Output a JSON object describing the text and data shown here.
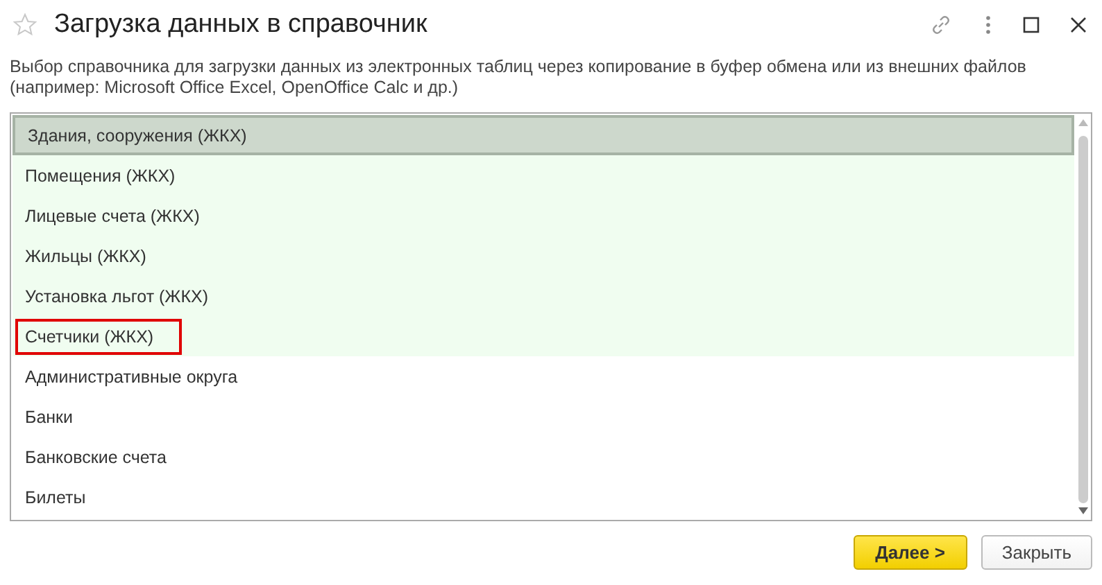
{
  "window": {
    "title": "Загрузка данных в справочник",
    "favorite": false
  },
  "description": "Выбор справочника для загрузки данных из электронных таблиц через копирование в буфер обмена или из внешних файлов (например: Microsoft Office Excel, OpenOffice Calc и др.)",
  "list": [
    {
      "label": "Здания, сооружения (ЖКХ)",
      "selected": true,
      "tinted": true,
      "outlined": false
    },
    {
      "label": "Помещения (ЖКХ)",
      "selected": false,
      "tinted": true,
      "outlined": false
    },
    {
      "label": "Лицевые счета (ЖКХ)",
      "selected": false,
      "tinted": true,
      "outlined": false
    },
    {
      "label": "Жильцы (ЖКХ)",
      "selected": false,
      "tinted": true,
      "outlined": false
    },
    {
      "label": "Установка льгот (ЖКХ)",
      "selected": false,
      "tinted": true,
      "outlined": false
    },
    {
      "label": "Счетчики (ЖКХ)",
      "selected": false,
      "tinted": true,
      "outlined": true
    },
    {
      "label": "Административные округа",
      "selected": false,
      "tinted": false,
      "outlined": false
    },
    {
      "label": "Банки",
      "selected": false,
      "tinted": false,
      "outlined": false
    },
    {
      "label": "Банковские счета",
      "selected": false,
      "tinted": false,
      "outlined": false
    },
    {
      "label": "Билеты",
      "selected": false,
      "tinted": false,
      "outlined": false
    }
  ],
  "buttons": [
    {
      "label": "Далее >",
      "kind": "primary"
    },
    {
      "label": "Закрыть",
      "kind": "default"
    }
  ]
}
